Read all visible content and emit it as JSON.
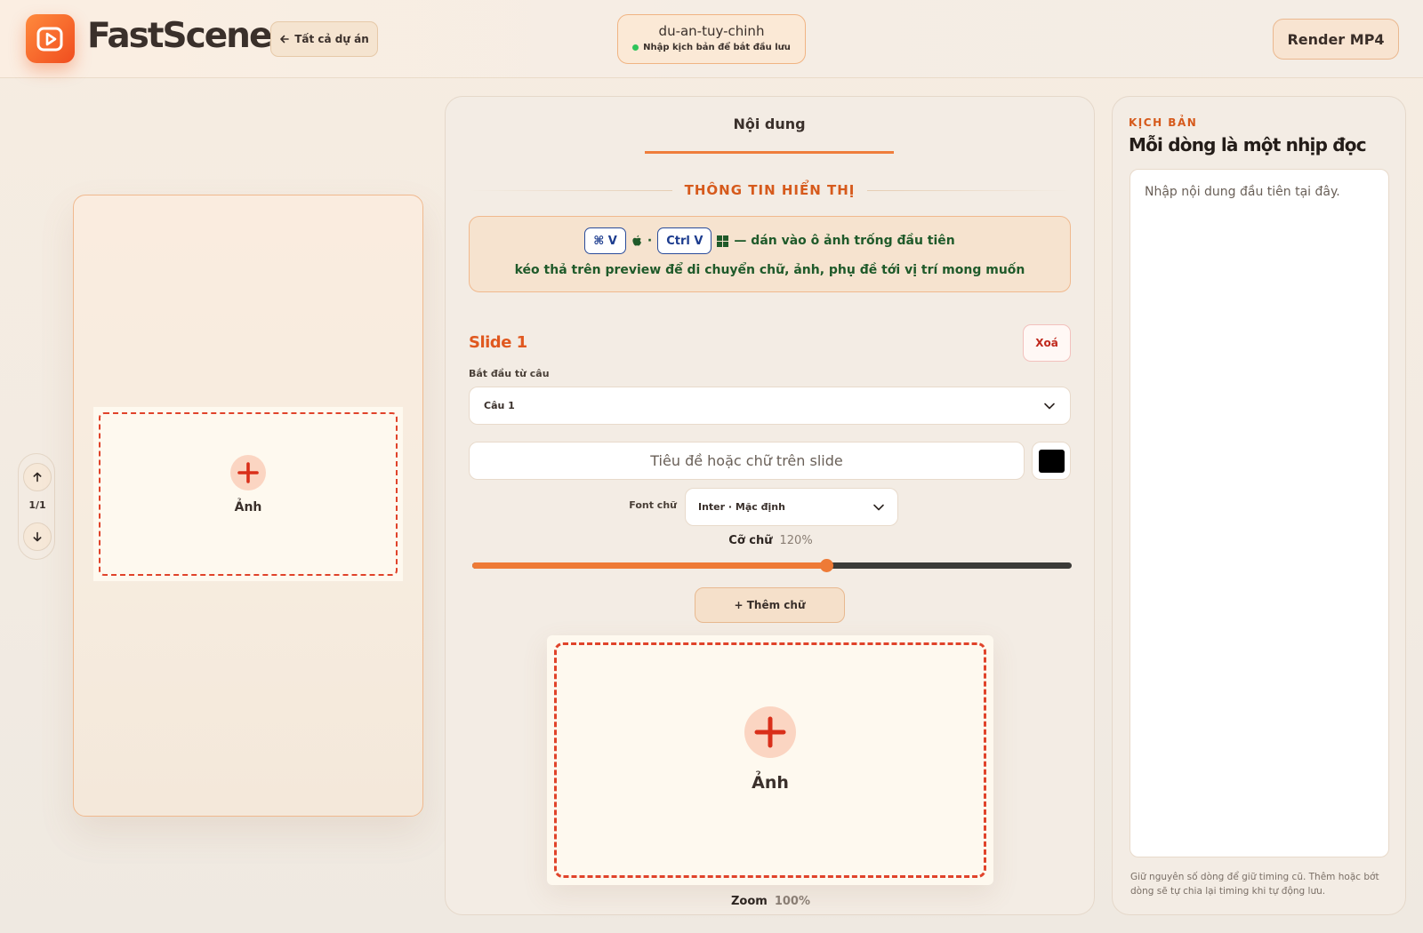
{
  "header": {
    "brand": "FastScene",
    "back_label": "Tất cả dự án",
    "project_name": "du-an-tuy-chinh",
    "project_status": "Nhập kịch bản để bắt đầu lưu",
    "render_label": "Render MP4"
  },
  "preview": {
    "page_indicator": "1/1",
    "image_slot_label": "Ảnh"
  },
  "editor": {
    "tab_label": "Nội dung",
    "section_title": "THÔNG TIN HIỂN THỊ",
    "tips": {
      "mac_shortcut": "⌘ V",
      "win_shortcut": "Ctrl V",
      "paste_text": "— dán vào ô ảnh trống đầu tiên",
      "drag_text": "kéo thả trên preview để di chuyển chữ, ảnh, phụ đề tới vị trí mong muốn"
    },
    "slide_title": "Slide 1",
    "delete_label": "Xoá",
    "start_label": "Bắt đầu từ câu",
    "start_value": "Câu 1",
    "text_placeholder": "Tiêu đề hoặc chữ trên slide",
    "text_color": "#000000",
    "font_label": "Font chữ",
    "font_value": "Inter · Mặc định",
    "size_label": "Cỡ chữ",
    "size_value": "120%",
    "size_fraction": 0.59,
    "add_text_label": "+ Thêm chữ",
    "image_slot_label": "Ảnh",
    "zoom_label": "Zoom",
    "zoom_value": "100%"
  },
  "script": {
    "kicker": "KỊCH BẢN",
    "title": "Mỗi dòng là một nhịp đọc",
    "placeholder": "Nhập nội dung đầu tiên tại đây.",
    "note": "Giữ nguyên số dòng để giữ timing cũ. Thêm hoặc bớt dòng sẽ tự chia lại timing khi tự động lưu."
  },
  "colors": {
    "accent": "#ef7d3b",
    "accent_text": "#d65a1c",
    "danger": "#e0432a",
    "tip_text": "#1f5a2a",
    "status_dot": "#2fc45a"
  },
  "icons": [
    "play-logo-icon",
    "arrow-left-icon",
    "arrow-up-icon",
    "arrow-down-icon",
    "plus-icon",
    "chevron-down-icon",
    "apple-icon",
    "windows-icon"
  ]
}
